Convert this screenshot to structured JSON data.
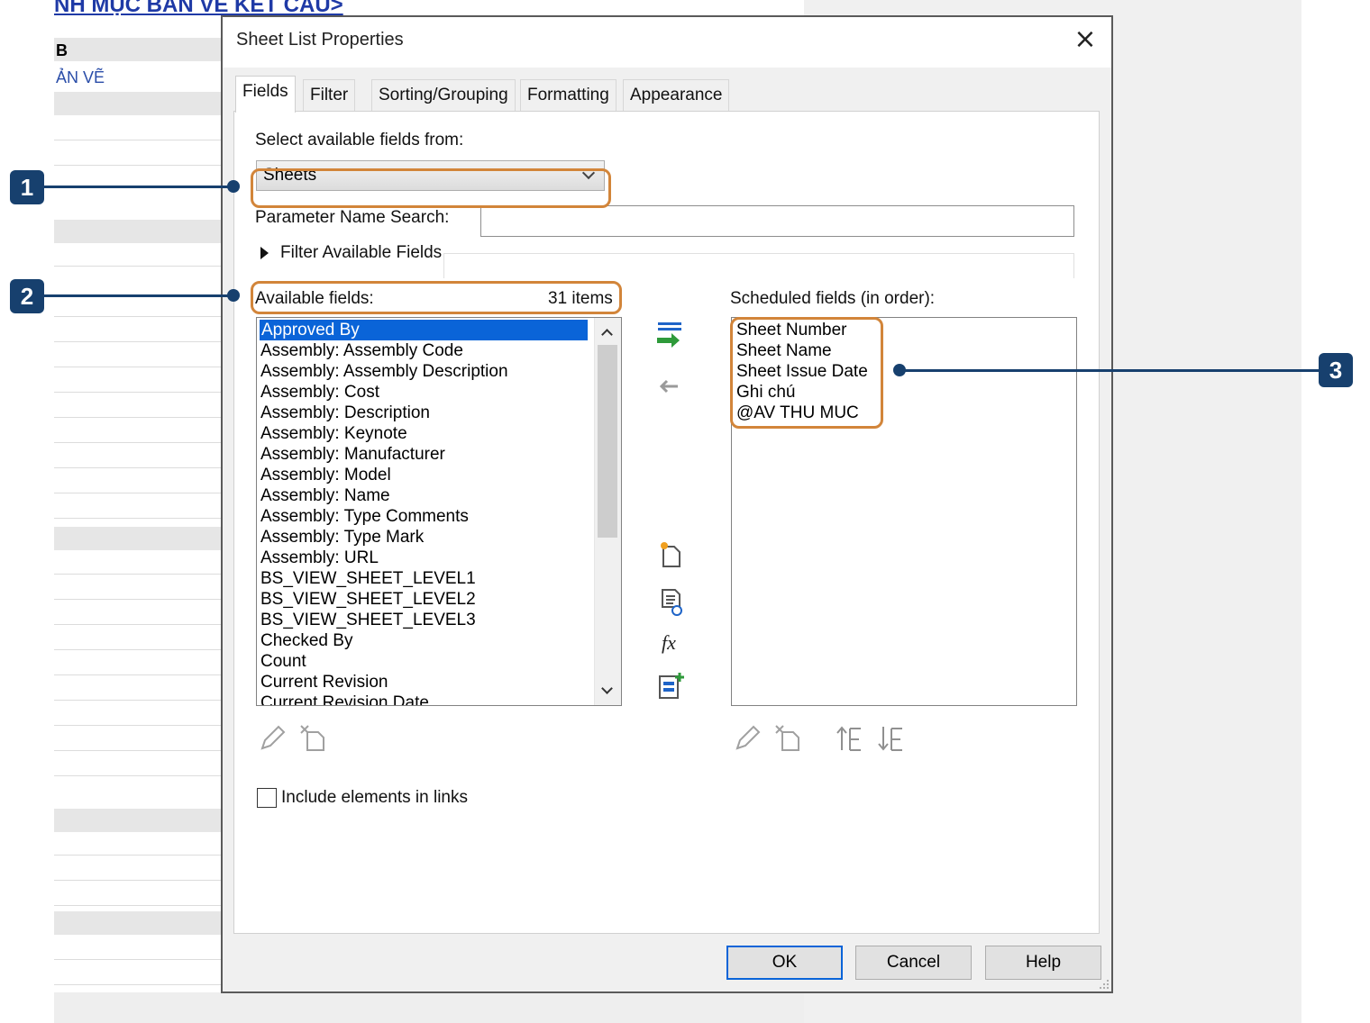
{
  "background": {
    "title_fragment": "NH MỤC BẢN VẼ KẾT CẤU>",
    "cell_b": "B",
    "cell_anve": "ẢN VẼ"
  },
  "dialog": {
    "title": "Sheet List Properties",
    "close_glyph": "×",
    "tabs": [
      {
        "label": "Fields",
        "active": true
      },
      {
        "label": "Filter"
      },
      {
        "label": "Sorting/Grouping"
      },
      {
        "label": "Formatting"
      },
      {
        "label": "Appearance"
      }
    ],
    "select_fields_label": "Select available fields from:",
    "select_fields_value": "Sheets",
    "param_search_label": "Parameter Name Search:",
    "param_search_value": "",
    "filter_available_label": "Filter Available Fields",
    "available_label": "Available fields:",
    "available_count": "31 items",
    "available_items": [
      "Approved By",
      "Assembly: Assembly Code",
      "Assembly: Assembly Description",
      "Assembly: Cost",
      "Assembly: Description",
      "Assembly: Keynote",
      "Assembly: Manufacturer",
      "Assembly: Model",
      "Assembly: Name",
      "Assembly: Type Comments",
      "Assembly: Type Mark",
      "Assembly: URL",
      "BS_VIEW_SHEET_LEVEL1",
      "BS_VIEW_SHEET_LEVEL2",
      "BS_VIEW_SHEET_LEVEL3",
      "Checked By",
      "Count",
      "Current Revision",
      "Current Revision Date"
    ],
    "selected_available": "Approved By",
    "scheduled_label": "Scheduled fields (in order):",
    "scheduled_items": [
      "Sheet Number",
      "Sheet Name",
      "Sheet Issue Date",
      "Ghi chú",
      "@AV THU MUC"
    ],
    "include_links_label": "Include elements in links",
    "include_links_checked": false,
    "buttons": {
      "ok": "OK",
      "cancel": "Cancel",
      "help": "Help"
    }
  },
  "callouts": [
    "1",
    "2",
    "3"
  ],
  "colors": {
    "accent": "#0a64d8",
    "highlight": "#d2853a",
    "callout": "#17406e"
  }
}
